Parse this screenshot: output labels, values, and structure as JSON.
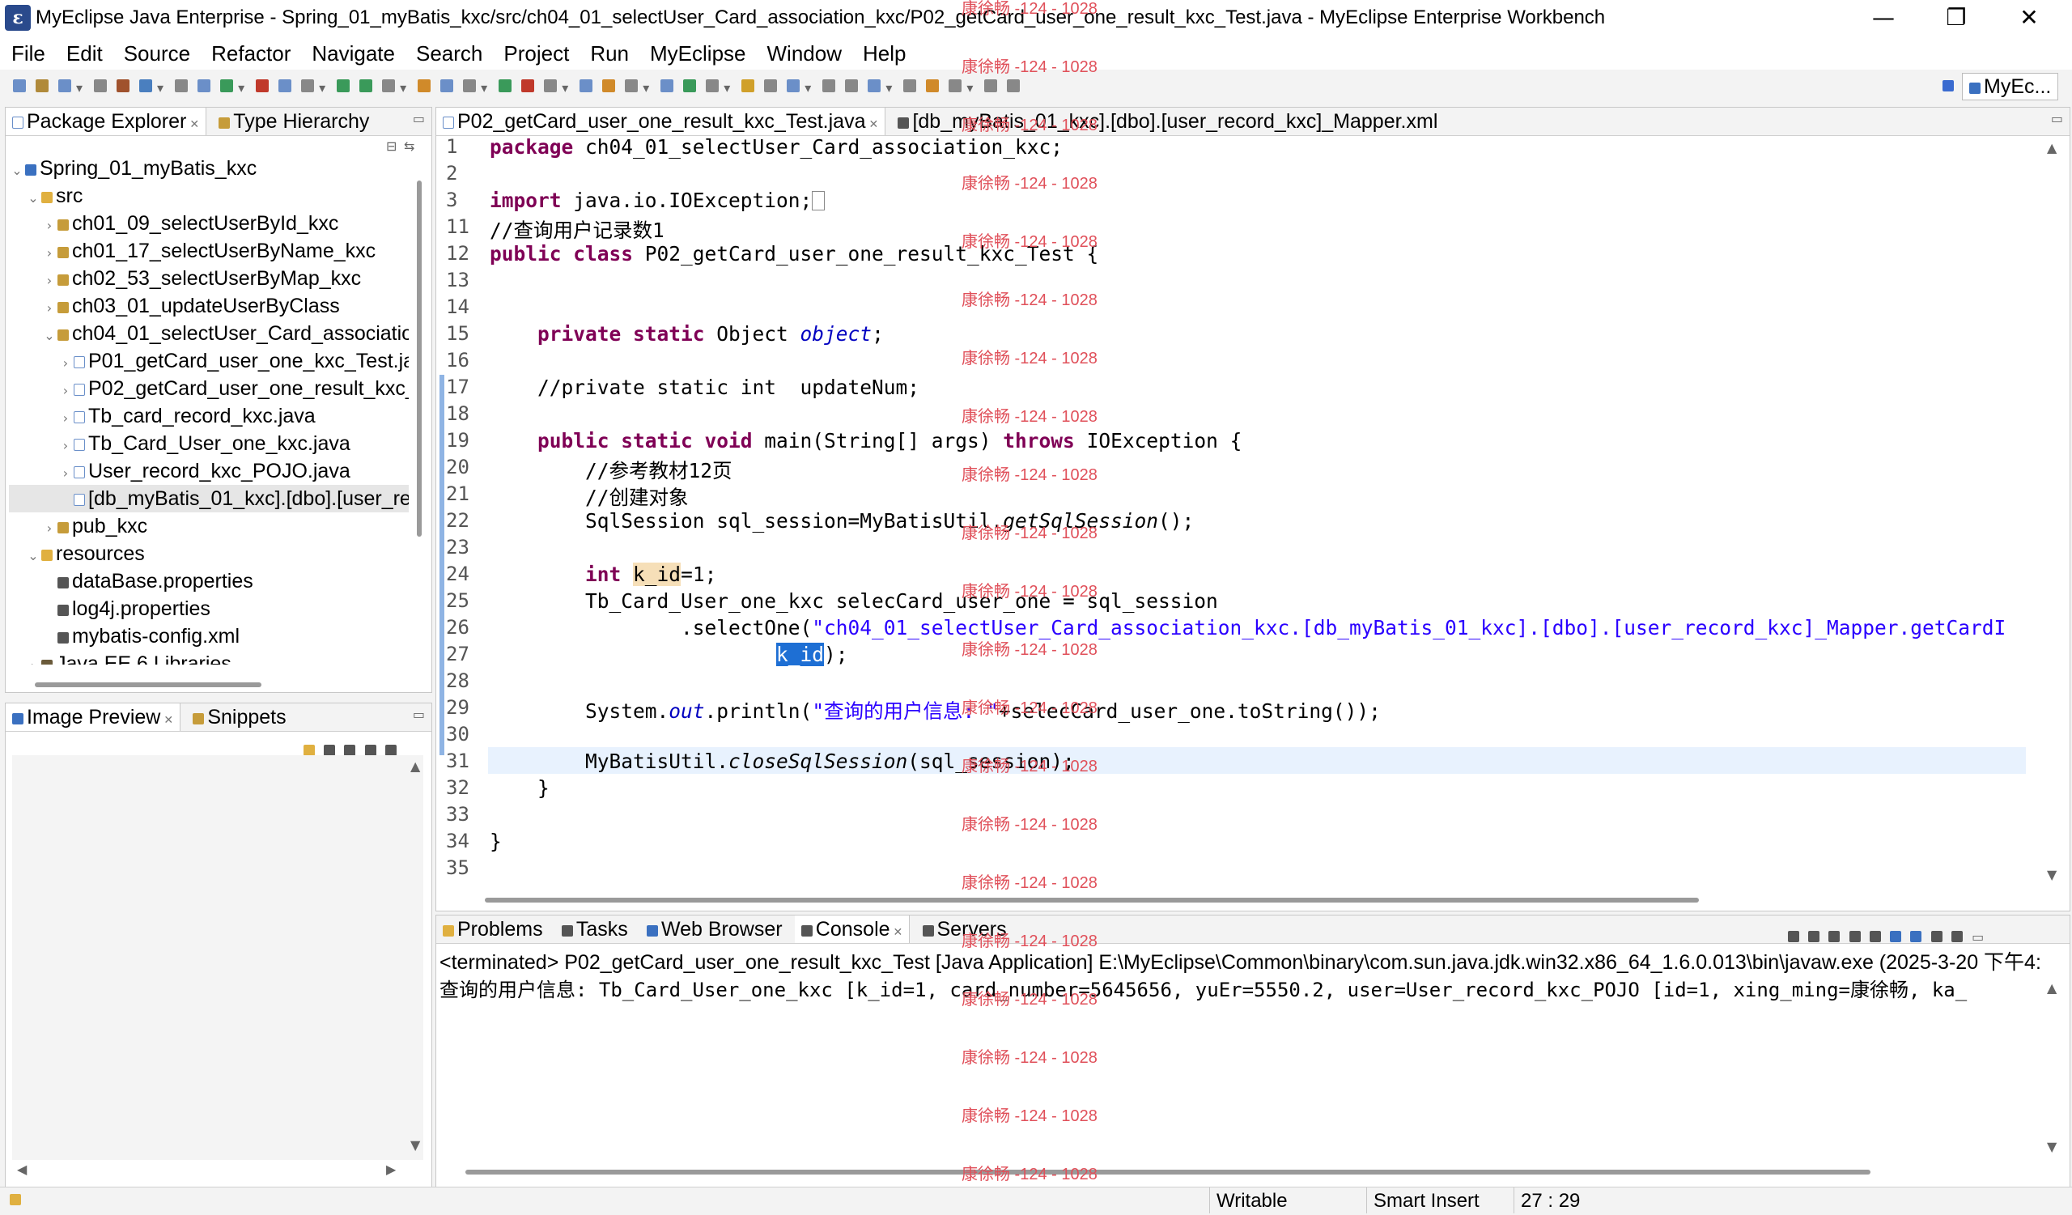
{
  "window": {
    "title": "MyEclipse Java Enterprise - Spring_01_myBatis_kxc/src/ch04_01_selectUser_Card_association_kxc/P02_getCard_user_one_result_kxc_Test.java - MyEclipse Enterprise Workbench",
    "minimize": "—",
    "restore": "❐",
    "close": "✕"
  },
  "menu": [
    "File",
    "Edit",
    "Source",
    "Refactor",
    "Navigate",
    "Search",
    "Project",
    "Run",
    "MyEclipse",
    "Window",
    "Help"
  ],
  "perspective": {
    "label": "MyEc..."
  },
  "left_top_panel": {
    "tabs": [
      {
        "label": "Package Explorer",
        "close": "✕"
      },
      {
        "label": "Type Hierarchy"
      }
    ]
  },
  "tree": [
    {
      "label": "Spring_01_myBatis_kxc",
      "indent": 0,
      "twisty": "⌄",
      "icon": "prj"
    },
    {
      "label": "src",
      "indent": 1,
      "twisty": "⌄",
      "icon": "fld"
    },
    {
      "label": "ch01_09_selectUserById_kxc",
      "indent": 2,
      "twisty": "›",
      "icon": "pkg"
    },
    {
      "label": "ch01_17_selectUserByName_kxc",
      "indent": 2,
      "twisty": "›",
      "icon": "pkg"
    },
    {
      "label": "ch02_53_selectUserByMap_kxc",
      "indent": 2,
      "twisty": "›",
      "icon": "pkg"
    },
    {
      "label": "ch03_01_updateUserByClass",
      "indent": 2,
      "twisty": "›",
      "icon": "pkg"
    },
    {
      "label": "ch04_01_selectUser_Card_associatio",
      "indent": 2,
      "twisty": "⌄",
      "icon": "pkg"
    },
    {
      "label": "P01_getCard_user_one_kxc_Test.ja",
      "indent": 3,
      "twisty": "›",
      "icon": "jv"
    },
    {
      "label": "P02_getCard_user_one_result_kxc_",
      "indent": 3,
      "twisty": "›",
      "icon": "jv"
    },
    {
      "label": "Tb_card_record_kxc.java",
      "indent": 3,
      "twisty": "›",
      "icon": "jv"
    },
    {
      "label": "Tb_Card_User_one_kxc.java",
      "indent": 3,
      "twisty": "›",
      "icon": "jv"
    },
    {
      "label": "User_record_kxc_POJO.java",
      "indent": 3,
      "twisty": "›",
      "icon": "jv"
    },
    {
      "label": "[db_myBatis_01_kxc].[dbo].[user_re",
      "indent": 3,
      "twisty": "",
      "icon": "jv",
      "selected": true
    },
    {
      "label": "pub_kxc",
      "indent": 2,
      "twisty": "›",
      "icon": "pkg"
    },
    {
      "label": "resources",
      "indent": 1,
      "twisty": "⌄",
      "icon": "fld"
    },
    {
      "label": "dataBase.properties",
      "indent": 2,
      "twisty": "",
      "icon": "prop"
    },
    {
      "label": "log4j.properties",
      "indent": 2,
      "twisty": "",
      "icon": "prop"
    },
    {
      "label": "mybatis-config.xml",
      "indent": 2,
      "twisty": "",
      "icon": "prop"
    },
    {
      "label": "Java EE 6 Libraries",
      "indent": 1,
      "twisty": "›",
      "icon": "lib"
    }
  ],
  "left_bottom_panel": {
    "tabs": [
      {
        "label": "Image Preview",
        "close": "✕"
      },
      {
        "label": "Snippets"
      }
    ]
  },
  "editor": {
    "tabs": [
      {
        "label": "P02_getCard_user_one_result_kxc_Test.java",
        "close": "✕"
      },
      {
        "label": "[db_myBatis_01_kxc].[dbo].[user_record_kxc]_Mapper.xml"
      }
    ],
    "line_numbers": [
      "1",
      "2",
      "3",
      "11",
      "12",
      "13",
      "14",
      "15",
      "16",
      "17",
      "18",
      "19",
      "20",
      "21",
      "22",
      "23",
      "24",
      "25",
      "26",
      "27",
      "28",
      "29",
      "30",
      "31",
      "32",
      "33",
      "34",
      "35"
    ],
    "code": {
      "l1_kw": "package",
      "l1_rest": " ch04_01_selectUser_Card_association_kxc;",
      "l3_kw": "import",
      "l3_rest": " java.io.IOException;",
      "l11_cm": "//查询用户记录数1",
      "l12_kw": "public class",
      "l12_rest": " P02_getCard_user_one_result_kxc_Test {",
      "l15_kw": "private static",
      "l15_type": " Object ",
      "l15_field": "object",
      "l15_end": ";",
      "l17_cm": "//private static int  updateNum;",
      "l19_kw": "public static void",
      "l19_mid": " main(String[] args) ",
      "l19_kw2": "throws",
      "l19_end": " IOException {",
      "l20_cm": "//参考教材12页",
      "l21_cm": "//创建对象",
      "l22_a": "SqlSession sql_session=MyBatisUtil.",
      "l22_sm": "getSqlSession",
      "l22_b": "();",
      "l24_kw": "int",
      "l24_var": "k_id",
      "l24_end": "=1;",
      "l25": "Tb_Card_User_one_kxc selecCard_user_one = sql_session",
      "l26_a": ".selectOne(",
      "l26_st": "\"ch04_01_selectUser_Card_association_kxc.[db_myBatis_01_kxc].[dbo].[user_record_kxc]_Mapper.getCardI",
      "l27_var": "k_id",
      "l27_end": ");",
      "l29_a": "System.",
      "l29_out": "out",
      "l29_b": ".println(",
      "l29_st": "\"查询的用户信息: \"",
      "l29_c": "+selecCard_user_one.toString());",
      "l31_a": "MyBatisUtil.",
      "l31_sm": "closeSqlSession",
      "l31_b": "(sql_session);",
      "l32": "}",
      "l34": "}"
    }
  },
  "bottom_panel": {
    "tabs": [
      {
        "label": "Problems"
      },
      {
        "label": "Tasks"
      },
      {
        "label": "Web Browser"
      },
      {
        "label": "Console",
        "close": "✕"
      },
      {
        "label": "Servers"
      }
    ],
    "console_header": "<terminated> P02_getCard_user_one_result_kxc_Test [Java Application] E:\\MyEclipse\\Common\\binary\\com.sun.java.jdk.win32.x86_64_1.6.0.013\\bin\\javaw.exe (2025-3-20 下午4:",
    "console_output": "查询的用户信息: Tb_Card_User_one_kxc [k_id=1, card_number=5645656, yuEr=5550.2, user=User_record_kxc_POJO [id=1, xing_ming=康徐畅, ka_"
  },
  "watermark": "康徐畅 -124 - 1028",
  "status": {
    "writable": "Writable",
    "insert_mode": "Smart Insert",
    "position": "27 : 29"
  }
}
